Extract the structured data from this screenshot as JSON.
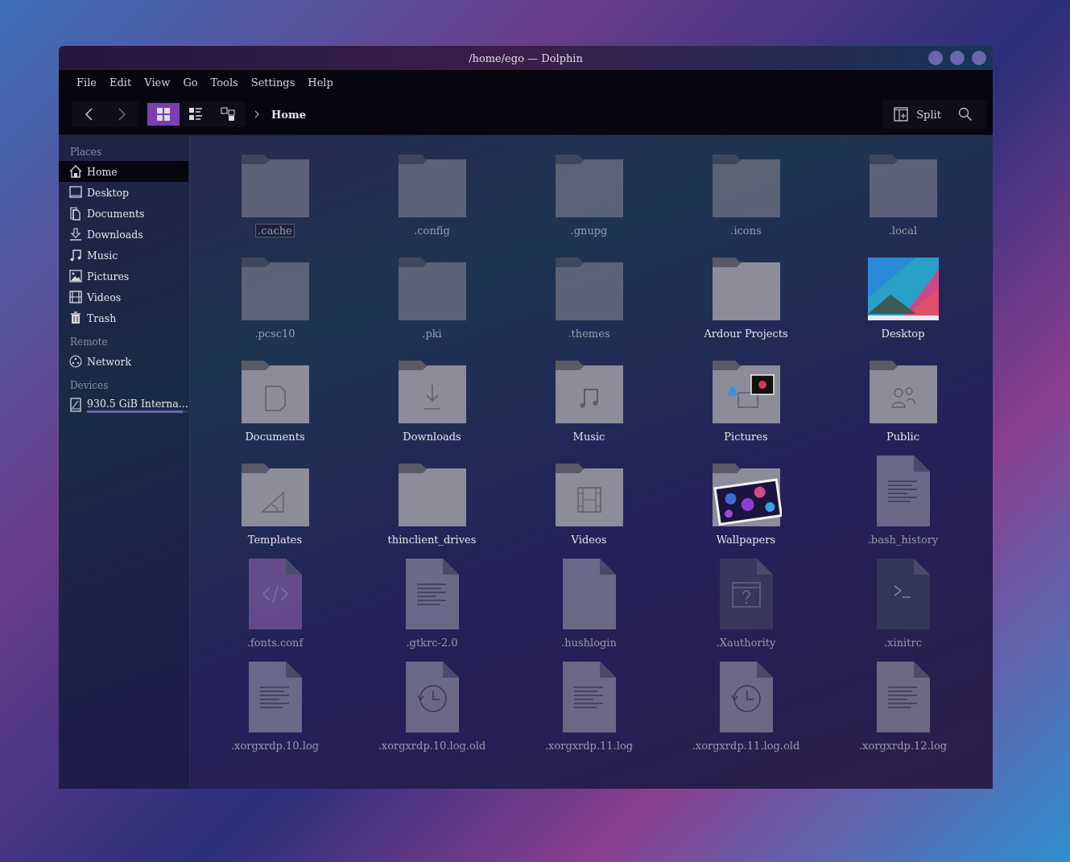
{
  "window": {
    "title": "/home/ego — Dolphin"
  },
  "menu": [
    "File",
    "Edit",
    "View",
    "Go",
    "Tools",
    "Settings",
    "Help"
  ],
  "toolbar": {
    "view_modes": [
      {
        "kind": "icons",
        "selected": true
      },
      {
        "kind": "details",
        "selected": false
      },
      {
        "kind": "tree",
        "selected": false
      }
    ],
    "breadcrumb": "Home",
    "split": "Split"
  },
  "sidebar": [
    {
      "heading": "Places",
      "items": [
        {
          "label": "Home",
          "kind": "home",
          "selected": true
        },
        {
          "label": "Desktop",
          "kind": "desktop",
          "selected": false
        },
        {
          "label": "Documents",
          "kind": "documents",
          "selected": false
        },
        {
          "label": "Downloads",
          "kind": "downloads",
          "selected": false
        },
        {
          "label": "Music",
          "kind": "music",
          "selected": false
        },
        {
          "label": "Pictures",
          "kind": "pictures",
          "selected": false
        },
        {
          "label": "Videos",
          "kind": "videos",
          "selected": false
        },
        {
          "label": "Trash",
          "kind": "trash",
          "selected": false
        }
      ]
    },
    {
      "heading": "Remote",
      "items": [
        {
          "label": "Network",
          "kind": "network",
          "selected": false
        }
      ]
    },
    {
      "heading": "Devices",
      "items": [
        {
          "label": "930.5 GiB Interna...",
          "kind": "drive",
          "selected": false,
          "level": 0.95
        }
      ]
    }
  ],
  "files": [
    {
      "name": ".cache",
      "kind": "folder",
      "hidden": true,
      "focused": true
    },
    {
      "name": ".config",
      "kind": "folder",
      "hidden": true,
      "focused": false
    },
    {
      "name": ".gnupg",
      "kind": "folder",
      "hidden": true,
      "focused": false
    },
    {
      "name": ".icons",
      "kind": "folder",
      "hidden": true,
      "focused": false
    },
    {
      "name": ".local",
      "kind": "folder",
      "hidden": true,
      "focused": false
    },
    {
      "name": ".pcsc10",
      "kind": "folder",
      "hidden": true,
      "focused": false
    },
    {
      "name": ".pki",
      "kind": "folder",
      "hidden": true,
      "focused": false
    },
    {
      "name": ".themes",
      "kind": "folder",
      "hidden": true,
      "focused": false
    },
    {
      "name": "Ardour Projects",
      "kind": "folder",
      "hidden": false,
      "focused": false
    },
    {
      "name": "Desktop",
      "kind": "image",
      "hidden": false,
      "focused": false
    },
    {
      "name": "Documents",
      "kind": "documents-folder",
      "hidden": false,
      "focused": false
    },
    {
      "name": "Downloads",
      "kind": "downloads-folder",
      "hidden": false,
      "focused": false
    },
    {
      "name": "Music",
      "kind": "music-folder",
      "hidden": false,
      "focused": false
    },
    {
      "name": "Pictures",
      "kind": "pictures-folder",
      "hidden": false,
      "focused": false
    },
    {
      "name": "Public",
      "kind": "public-folder",
      "hidden": false,
      "focused": false
    },
    {
      "name": "Templates",
      "kind": "templates-folder",
      "hidden": false,
      "focused": false
    },
    {
      "name": "thinclient_drives",
      "kind": "folder",
      "hidden": false,
      "focused": false
    },
    {
      "name": "Videos",
      "kind": "videos-folder",
      "hidden": false,
      "focused": false
    },
    {
      "name": "Wallpapers",
      "kind": "wallpapers-folder",
      "hidden": false,
      "focused": false
    },
    {
      "name": ".bash_history",
      "kind": "text",
      "hidden": true,
      "focused": false
    },
    {
      "name": ".fonts.conf",
      "kind": "code",
      "hidden": true,
      "focused": false
    },
    {
      "name": ".gtkrc-2.0",
      "kind": "text",
      "hidden": true,
      "focused": false
    },
    {
      "name": ".hushlogin",
      "kind": "blank",
      "hidden": true,
      "focused": false
    },
    {
      "name": ".Xauthority",
      "kind": "unknown",
      "hidden": true,
      "focused": false
    },
    {
      "name": ".xinitrc",
      "kind": "script",
      "hidden": true,
      "focused": false
    },
    {
      "name": ".xorgxrdp.10.log",
      "kind": "text",
      "hidden": true,
      "focused": false
    },
    {
      "name": ".xorgxrdp.10.log.old",
      "kind": "backup",
      "hidden": true,
      "focused": false
    },
    {
      "name": ".xorgxrdp.11.log",
      "kind": "text",
      "hidden": true,
      "focused": false
    },
    {
      "name": ".xorgxrdp.11.log.old",
      "kind": "backup",
      "hidden": true,
      "focused": false
    },
    {
      "name": ".xorgxrdp.12.log",
      "kind": "text",
      "hidden": true,
      "focused": false
    }
  ]
}
